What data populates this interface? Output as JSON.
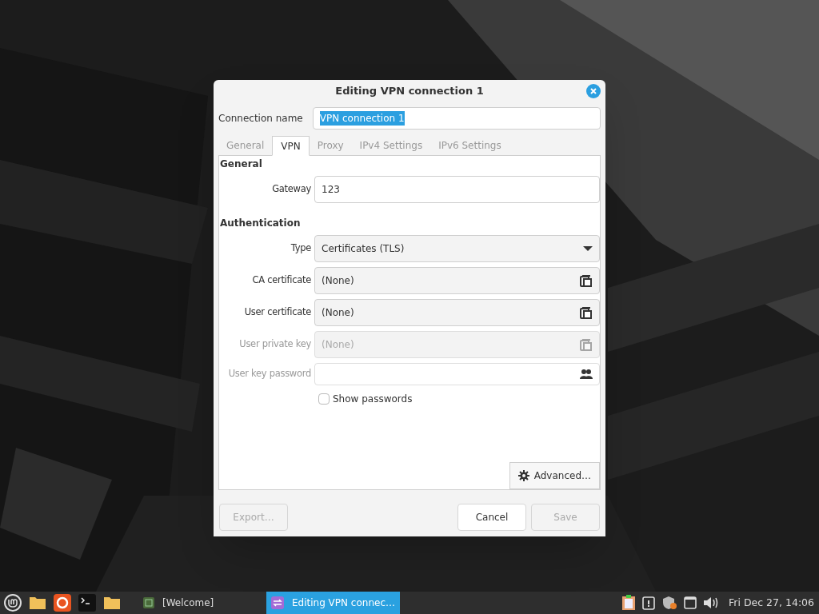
{
  "window": {
    "title": "Editing VPN connection 1"
  },
  "connection_name": {
    "label": "Connection name",
    "value": "VPN connection 1",
    "selected": true
  },
  "tabs": [
    {
      "label": "General",
      "selected": false
    },
    {
      "label": "VPN",
      "selected": true
    },
    {
      "label": "Proxy",
      "selected": false
    },
    {
      "label": "IPv4 Settings",
      "selected": false
    },
    {
      "label": "IPv6 Settings",
      "selected": false
    }
  ],
  "sections": [
    {
      "heading": "General",
      "fields": [
        {
          "kind": "entry",
          "label": "Gateway",
          "value": "123",
          "disabled": false
        }
      ]
    },
    {
      "heading": "Authentication",
      "fields": [
        {
          "kind": "combo",
          "label": "Type",
          "value": "Certificates (TLS)",
          "disabled": false
        },
        {
          "kind": "file",
          "label": "CA certificate",
          "value": "(None)",
          "disabled": false
        },
        {
          "kind": "file",
          "label": "User certificate",
          "value": "(None)",
          "disabled": false
        },
        {
          "kind": "file",
          "label": "User private key",
          "value": "(None)",
          "disabled": true
        },
        {
          "kind": "password",
          "label": "User key password",
          "disabled": true
        }
      ]
    }
  ],
  "show_passwords": {
    "label": "Show passwords",
    "checked": false
  },
  "advanced_button": {
    "label": "Advanced…"
  },
  "buttons": [
    {
      "label": "Export…",
      "disabled": true
    },
    {
      "label": "Cancel",
      "disabled": false
    },
    {
      "label": "Save",
      "disabled": true
    }
  ],
  "taskbar": {
    "launchers": [
      {
        "kind": "menu"
      },
      {
        "kind": "folder"
      },
      {
        "kind": "browser"
      },
      {
        "kind": "terminal"
      },
      {
        "kind": "folder"
      }
    ],
    "windows": [
      {
        "label": "[Welcome]",
        "selected": false
      },
      {
        "label": "Editing VPN connec…",
        "selected": true
      }
    ],
    "clock": "Fri Dec 27, 14:06"
  }
}
